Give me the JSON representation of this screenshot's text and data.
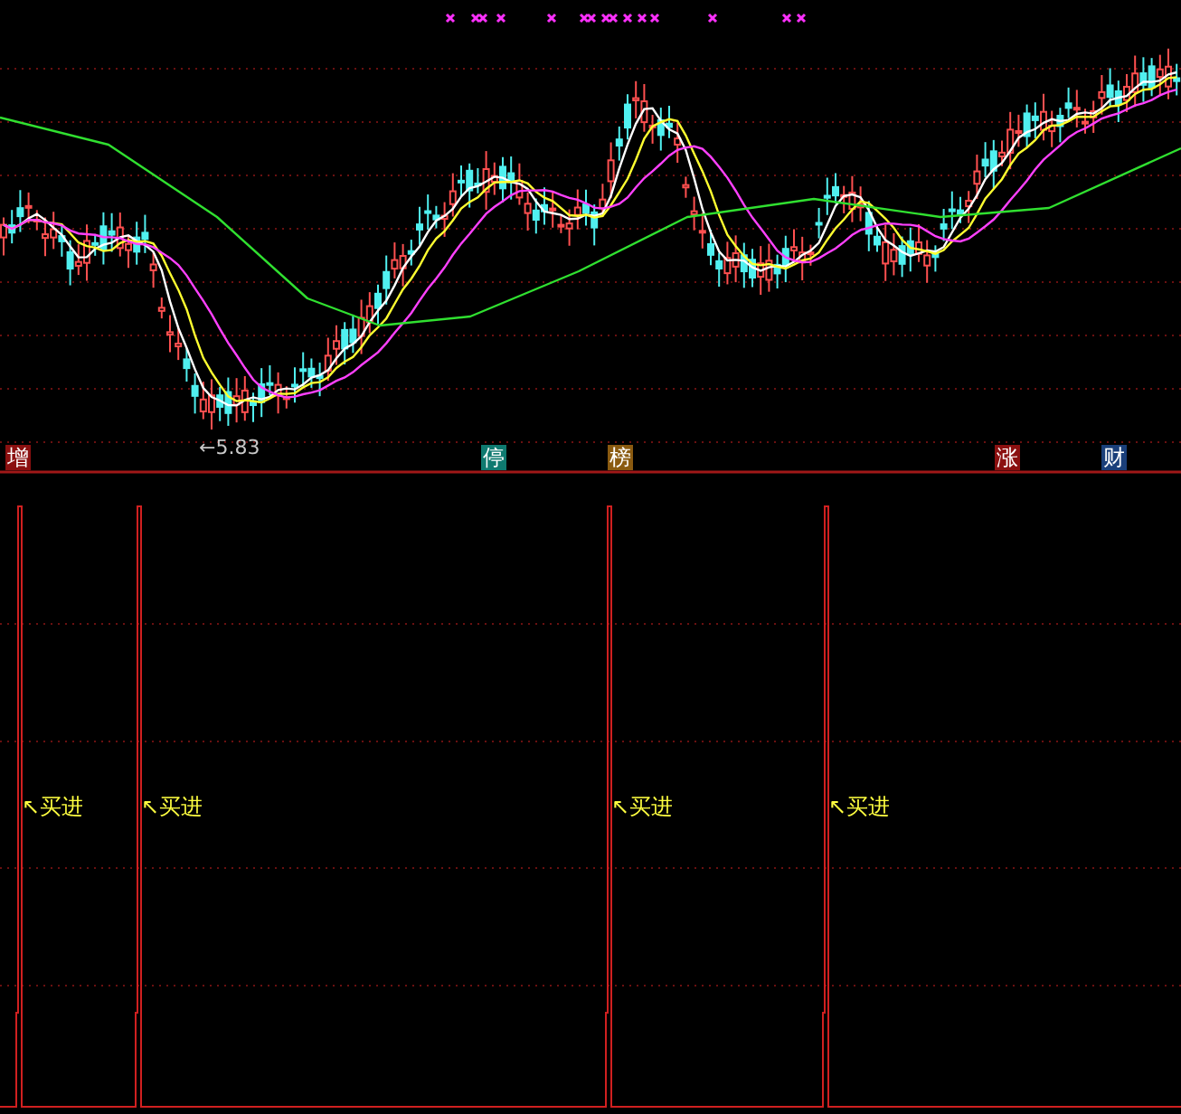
{
  "price_panel": {
    "low_label": "←5.83",
    "tags": [
      {
        "label": "增",
        "color": "#8b1010"
      },
      {
        "label": "停",
        "color": "#0f7a70"
      },
      {
        "label": "榜",
        "color": "#8a5a10"
      },
      {
        "label": "涨",
        "color": "#8b1010"
      },
      {
        "label": "财",
        "color": "#1a3f7a"
      }
    ]
  },
  "signal_panel": {
    "signals": [
      {
        "label": "↖买进"
      },
      {
        "label": "↖买进"
      },
      {
        "label": "↖买进"
      },
      {
        "label": "↖买进"
      }
    ]
  }
}
